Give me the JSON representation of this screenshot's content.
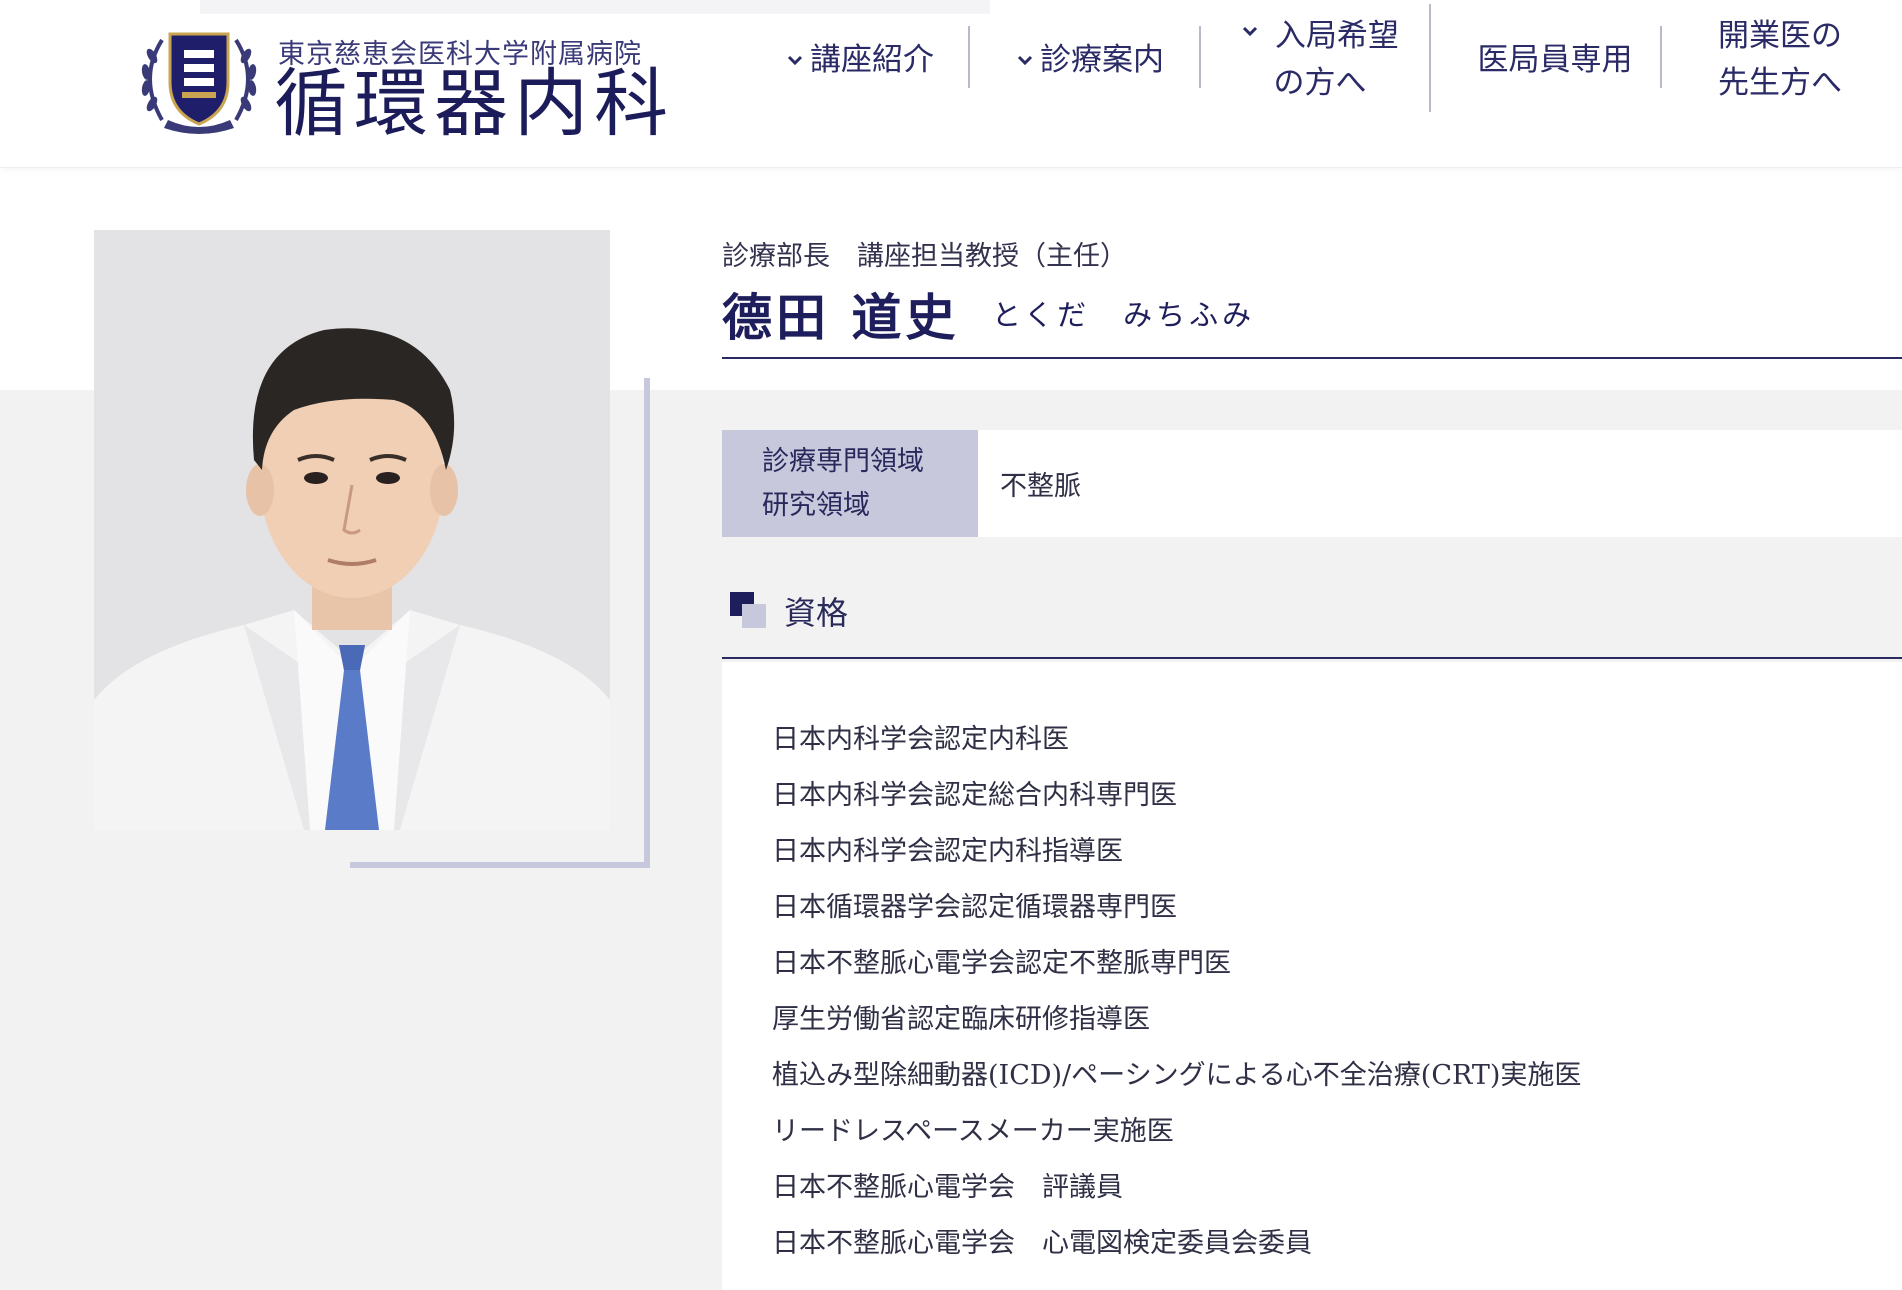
{
  "header": {
    "logo_sub": "東京慈恵会医科大学附属病院",
    "logo_main": "循環器内科",
    "nav": [
      {
        "label": "講座紹介",
        "dropdown": true
      },
      {
        "label": "診療案内",
        "dropdown": true
      },
      {
        "label_line1": "入局希望",
        "label_line2": "の方へ",
        "dropdown": true
      },
      {
        "label": "医局員専用",
        "dropdown": false
      },
      {
        "label_line1": "開業医の",
        "label_line2": "先生方へ",
        "dropdown": false
      }
    ]
  },
  "profile": {
    "position": "診療部長　講座担当教授（主任）",
    "name": "德田 道史",
    "name_kana": "とくだ　みちふみ",
    "specialty_label_line1": "診療専門領域",
    "specialty_label_line2": "研究領域",
    "specialty_value": "不整脈"
  },
  "qualifications": {
    "title": "資格",
    "items": [
      "日本内科学会認定内科医",
      "日本内科学会認定総合内科専門医",
      "日本内科学会認定内科指導医",
      "日本循環器学会認定循環器専門医",
      "日本不整脈心電学会認定不整脈専門医",
      "厚生労働省認定臨床研修指導医",
      "植込み型除細動器(ICD)/ペーシングによる心不全治療(CRT)実施医",
      "リードレスペースメーカー実施医",
      "日本不整脈心電学会　評議員",
      "日本不整脈心電学会　心電図検定委員会委員"
    ]
  },
  "colors": {
    "navy": "#1c1c5a",
    "lavender": "#c8c8dc",
    "background_gray": "#f2f2f3"
  }
}
